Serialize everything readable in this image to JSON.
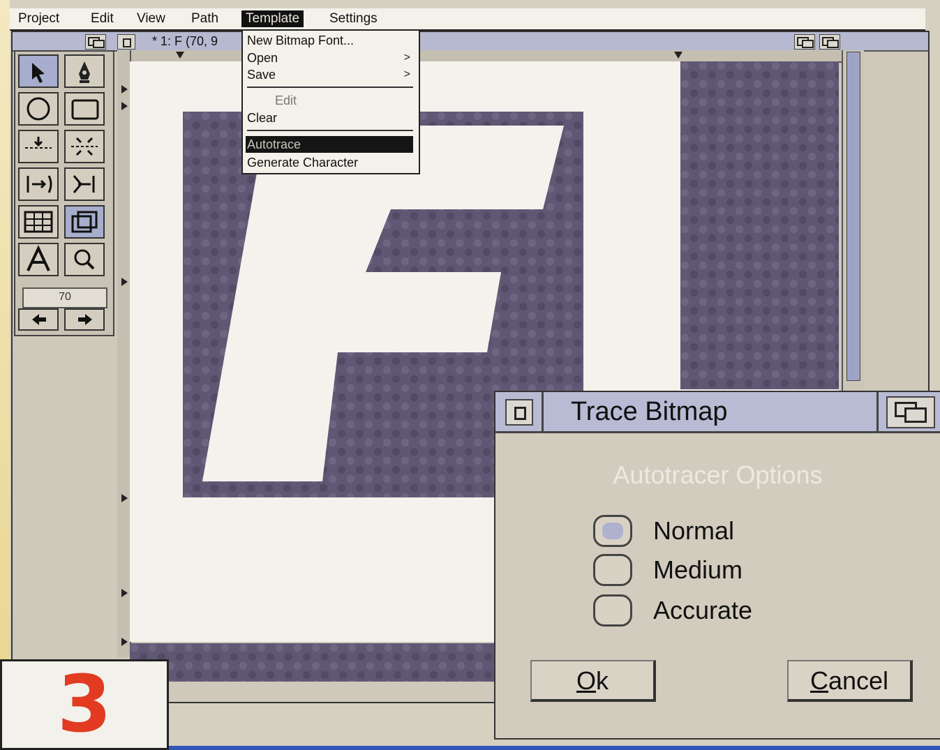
{
  "menubar": {
    "items": [
      "Project",
      "Edit",
      "View",
      "Path",
      "Template",
      "Settings"
    ],
    "active": "Template"
  },
  "window": {
    "title": "* 1: F (70, 9"
  },
  "toolbox": {
    "zoom_value": "70"
  },
  "template_menu": {
    "items": [
      {
        "label": "New Bitmap Font...",
        "submenu": false,
        "enabled": true
      },
      {
        "label": "Open",
        "submenu": true,
        "enabled": true
      },
      {
        "label": "Save",
        "submenu": true,
        "enabled": true
      },
      {
        "label": "Edit",
        "submenu": false,
        "enabled": false
      },
      {
        "label": "Clear",
        "submenu": false,
        "enabled": true
      },
      {
        "label": "Autotrace",
        "submenu": false,
        "enabled": true,
        "highlighted": true
      },
      {
        "label": "Generate Character",
        "submenu": false,
        "enabled": true
      }
    ],
    "submenu_glyph": ">"
  },
  "dialog": {
    "title": "Trace Bitmap",
    "section_title": "Autotracer Options",
    "options": [
      {
        "label": "Normal",
        "selected": true
      },
      {
        "label": "Medium",
        "selected": false
      },
      {
        "label": "Accurate",
        "selected": false
      }
    ],
    "ok_mnemonic": "O",
    "ok_rest": "k",
    "cancel_mnemonic": "C",
    "cancel_rest": "ancel"
  },
  "badge": {
    "number": "3"
  },
  "colors": {
    "background_blue": "#2f56b8",
    "titlebar": "#b6b9cf",
    "pattern": "#5f5874",
    "badge_number": "#e23b22"
  }
}
